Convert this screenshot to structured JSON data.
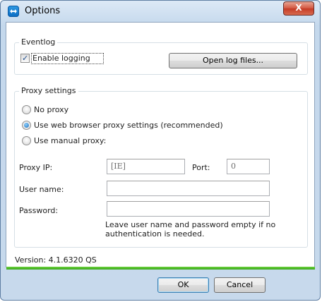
{
  "window": {
    "title": "Options",
    "close_symbol": "X"
  },
  "eventlog": {
    "legend": "Eventlog",
    "enable_logging_label": "Enable logging",
    "enable_logging_checked": true,
    "open_log_files_label": "Open log files..."
  },
  "proxy": {
    "legend": "Proxy settings",
    "options": [
      {
        "label": "No proxy",
        "selected": false
      },
      {
        "label": "Use web browser proxy settings (recommended)",
        "selected": true
      },
      {
        "label": "Use manual proxy:",
        "selected": false
      }
    ],
    "proxy_ip_label": "Proxy IP:",
    "proxy_ip_value": "[IE]",
    "port_label": "Port:",
    "port_value": "0",
    "user_name_label": "User name:",
    "user_name_value": "",
    "password_label": "Password:",
    "password_value": "",
    "hint_line1": "Leave user name and password empty if no",
    "hint_line2": "authentication is needed."
  },
  "version_text": "Version: 4.1.6320 QS",
  "buttons": {
    "ok": "OK",
    "cancel": "Cancel"
  },
  "colors": {
    "accent_green": "#3aa51b",
    "title_bar": "#c4d8ec",
    "close_red": "#c43a25"
  }
}
